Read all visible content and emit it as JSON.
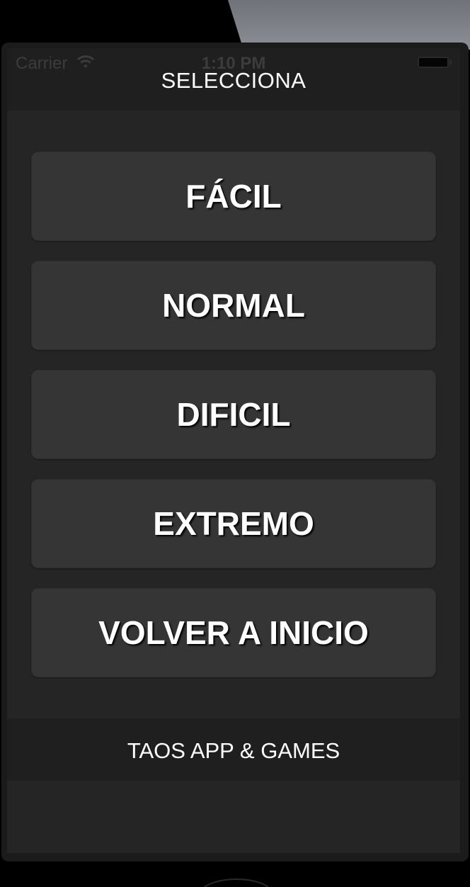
{
  "status_bar": {
    "carrier": "Carrier",
    "time": "1:10 PM",
    "wifi_icon": "wifi-icon",
    "battery_icon": "battery-icon"
  },
  "nav": {
    "title": "SELECCIONA"
  },
  "menu": {
    "buttons": [
      {
        "label": "FÁCIL"
      },
      {
        "label": "NORMAL"
      },
      {
        "label": "DIFICIL"
      },
      {
        "label": "EXTREMO"
      },
      {
        "label": "VOLVER A INICIO"
      }
    ]
  },
  "footer": {
    "text": "TAOS APP & GAMES"
  },
  "colors": {
    "background": "#252525",
    "bar": "#1f1f1f",
    "button": "#353535",
    "text": "#ffffff"
  }
}
